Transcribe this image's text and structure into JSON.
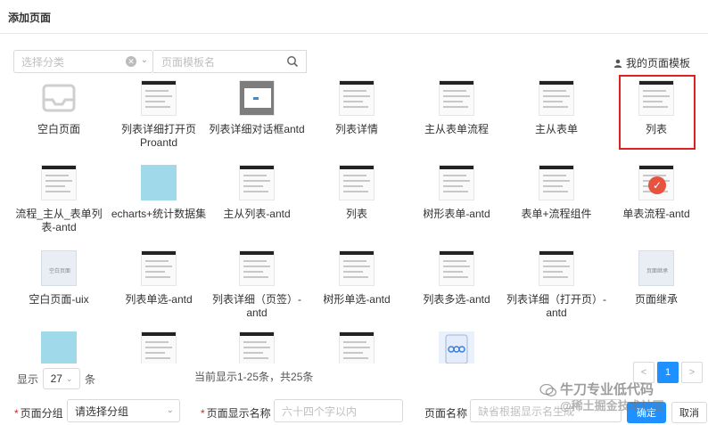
{
  "window": {
    "title": "添加页面"
  },
  "filters": {
    "category_placeholder": "选择分类",
    "template_placeholder": "页面模板名"
  },
  "my_templates": "我的页面模板",
  "templates": [
    {
      "label": "空白页面",
      "thumb": "inbox-icon"
    },
    {
      "label": "列表详细打开页Proantd",
      "thumb": "table"
    },
    {
      "label": "列表详细对话框antd",
      "thumb": "dialog"
    },
    {
      "label": "列表详情",
      "thumb": "table"
    },
    {
      "label": "主从表单流程",
      "thumb": "table"
    },
    {
      "label": "主从表单",
      "thumb": "table"
    },
    {
      "label": "列表",
      "thumb": "table"
    },
    {
      "label": "流程_主从_表单列表-antd",
      "thumb": "table"
    },
    {
      "label": "echarts+统计数据集",
      "thumb": "cyan"
    },
    {
      "label": "主从列表-antd",
      "thumb": "table"
    },
    {
      "label": "列表",
      "thumb": "table"
    },
    {
      "label": "树形表单-antd",
      "thumb": "table"
    },
    {
      "label": "表单+流程组件",
      "thumb": "table"
    },
    {
      "label": "单表流程-antd",
      "thumb": "table",
      "selected": true
    },
    {
      "label": "空白页面-uix",
      "thumb": "empty-ui",
      "mini": "空白页面"
    },
    {
      "label": "列表单选-antd",
      "thumb": "table"
    },
    {
      "label": "列表详细（页签）-antd",
      "thumb": "table"
    },
    {
      "label": "树形单选-antd",
      "thumb": "table"
    },
    {
      "label": "列表多选-antd",
      "thumb": "table"
    },
    {
      "label": "列表详细（打开页）-antd",
      "thumb": "table"
    },
    {
      "label": "页面继承",
      "thumb": "empty-ui",
      "mini": "页面继承"
    },
    {
      "label": "",
      "thumb": "cyan"
    },
    {
      "label": "",
      "thumb": "table"
    },
    {
      "label": "",
      "thumb": "table"
    },
    {
      "label": "",
      "thumb": "table"
    },
    {
      "label": "",
      "thumb": "doc"
    }
  ],
  "pagination": {
    "show_label": "显示",
    "page_size": "27",
    "unit": "条",
    "range_text": "当前显示1-25条，共25条",
    "current_page": "1",
    "prev": "<",
    "next": ">"
  },
  "form": {
    "group_label": "页面分组",
    "group_value": "请选择分组",
    "display_name_label": "页面显示名称",
    "display_name_placeholder": "六十四个字以内",
    "page_name_label": "页面名称",
    "page_name_placeholder": "缺省根据显示名生成",
    "ok": "确定",
    "cancel": "取消"
  },
  "watermark": {
    "line1": "牛刀专业低代码",
    "line2": "@稀土掘金技术社区"
  },
  "colors": {
    "accent": "#1e90ff",
    "selected_border": "#e02020",
    "check_badge": "#e8533f"
  }
}
